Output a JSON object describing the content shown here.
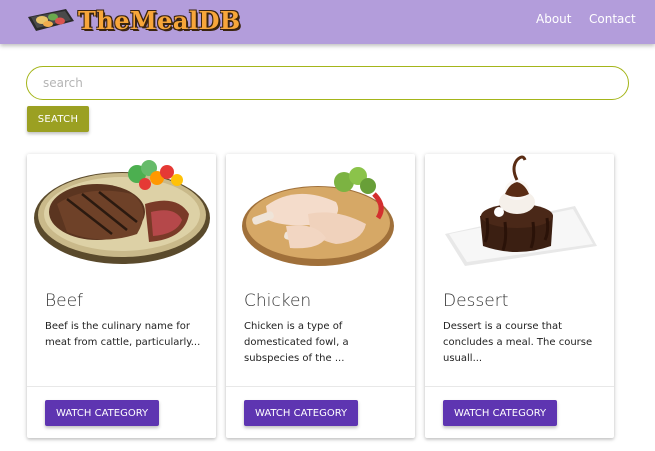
{
  "header": {
    "logo_text": "TheMealDB",
    "nav": [
      {
        "label": "About"
      },
      {
        "label": "Contact"
      }
    ]
  },
  "search": {
    "placeholder": "search",
    "value": "",
    "button_label": "SEATCH"
  },
  "categories": [
    {
      "title": "Beef",
      "description_line1": "Beef is the culinary name for",
      "description_line2": "meat from cattle, particularly...",
      "image_icon": "beef-steak-image",
      "button_label": "WATCH CATEGORY"
    },
    {
      "title": "Chicken",
      "description_line1": "Chicken is a type of",
      "description_line2": "domesticated fowl, a",
      "description_line3": "subspecies of the ...",
      "image_icon": "chicken-legs-image",
      "button_label": "WATCH CATEGORY"
    },
    {
      "title": "Dessert",
      "description_line1": "Dessert is a course that",
      "description_line2": "concludes a meal. The course",
      "description_line3": "usuall...",
      "image_icon": "chocolate-dessert-image",
      "button_label": "WATCH CATEGORY"
    }
  ],
  "colors": {
    "navbar": "#b39ddb",
    "search_accent": "#9ba022",
    "card_button": "#5e35b1"
  }
}
